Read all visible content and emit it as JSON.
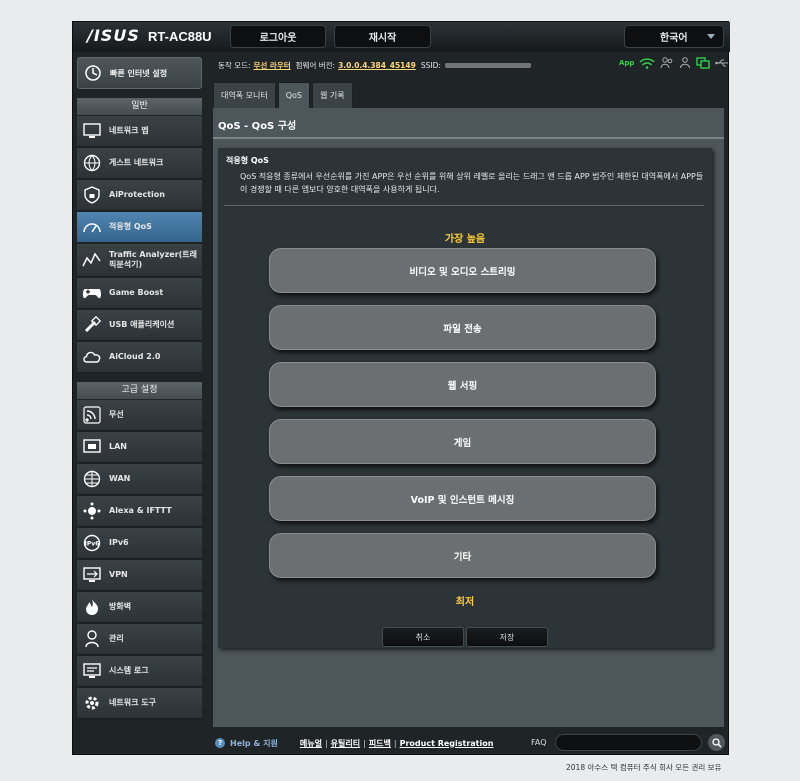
{
  "header": {
    "logo": "/ISUS",
    "model": "RT-AC88U",
    "logout_label": "로그아웃",
    "reboot_label": "재시작",
    "language": "한국어"
  },
  "sidebar": {
    "quick_setup": "빠른 인터넷 설정",
    "general_heading": "일반",
    "general_items": [
      {
        "label": "네트워크 맵",
        "icon": "network-map-icon"
      },
      {
        "label": "게스트 네트워크",
        "icon": "guest-network-icon"
      },
      {
        "label": "AiProtection",
        "icon": "shield-icon"
      },
      {
        "label": "적응형 QoS",
        "icon": "qos-gauge-icon"
      },
      {
        "label": "Traffic Analyzer(트래픽분석기)",
        "icon": "traffic-analyzer-icon"
      },
      {
        "label": "Game Boost",
        "icon": "gamepad-icon"
      },
      {
        "label": "USB 애플리케이션",
        "icon": "usb-icon"
      },
      {
        "label": "AiCloud 2.0",
        "icon": "cloud-icon"
      }
    ],
    "advanced_heading": "고급 설정",
    "advanced_items": [
      {
        "label": "무선",
        "icon": "wireless-icon"
      },
      {
        "label": "LAN",
        "icon": "lan-icon"
      },
      {
        "label": "WAN",
        "icon": "globe-icon"
      },
      {
        "label": "Alexa & IFTTT",
        "icon": "alexa-icon"
      },
      {
        "label": "IPv6",
        "icon": "ipv6-icon"
      },
      {
        "label": "VPN",
        "icon": "vpn-icon"
      },
      {
        "label": "방화벽",
        "icon": "firewall-icon"
      },
      {
        "label": "관리",
        "icon": "admin-icon"
      },
      {
        "label": "시스템 로그",
        "icon": "system-log-icon"
      },
      {
        "label": "네트워크 도구",
        "icon": "network-tools-icon"
      }
    ]
  },
  "status": {
    "mode_label": "동작 모드:",
    "mode_value": "무선 라우터",
    "firmware_label": "펌웨어 버전:",
    "firmware_value": "3.0.0.4.384_45149",
    "ssid_label": "SSID:",
    "app_label": "App"
  },
  "tabs": [
    "대역폭 모니터",
    "QoS",
    "웹 기록"
  ],
  "panel": {
    "title": "QoS - QoS 구성",
    "section_title": "적응형 QoS",
    "description": "QoS 적응형 종류에서 우선순위를 가진 APP은 우선 순위를 위해 상위 레벨로 올리는 드래그 앤 드롭 APP 범주인 제한된 대역폭에서 APP들이 경쟁할 때 다른 앱보다 양호한 대역폭을 사용하게 됩니다.",
    "highest_label": "가장 높음",
    "lowest_label": "최저",
    "categories": [
      "비디오 및 오디오 스트리밍",
      "파일 전송",
      "웹 서핑",
      "게임",
      "VoIP 및 인스턴트 메시징",
      "기타"
    ],
    "cancel_label": "취소",
    "save_label": "저장"
  },
  "footer": {
    "help_label": "Help & 지원",
    "links": [
      "메뉴얼",
      "유틸리티",
      "피드백",
      "Product Registration"
    ],
    "faq_label": "FAQ",
    "copyright": "2018 아수스 텍 컴퓨터 주식 회사 모든 권리 보유"
  },
  "colors": {
    "accent_active": "#4f86b2",
    "priority_label": "#ffcc33",
    "status_green": "#2fd14b"
  }
}
